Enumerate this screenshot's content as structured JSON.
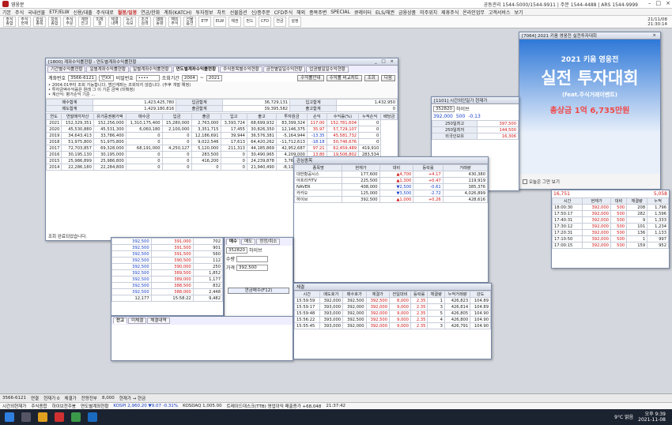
{
  "app": {
    "title": "영웅문",
    "status_bar": "공동관리 1544-5000/1544-9911 | 주문 1544-4488 | ARS 1544-9999"
  },
  "menu": [
    "기본",
    "주식",
    "국내선물",
    "ETF/ELW",
    "신용/대출",
    "주식대로",
    "월봉/일봉",
    "연금/한화",
    "계좌(KATCH)",
    "투자정보",
    "차트",
    "선물옵션",
    "신/종주문",
    "CFD주식",
    "해외",
    "종목주변",
    "SPECIAL",
    "큐레이터",
    "ELS/채권",
    "금융상품",
    "미주위치",
    "제휴주식",
    "온라인업무",
    "고객서비스",
    "보기"
  ],
  "toolbar": {
    "buttons": [
      "주식\n종합",
      "주식\n현재",
      "관심\n종목",
      "차트\n종합",
      "주식\n주문",
      "계좌\n잔고",
      "미체\n결",
      "체결\n내역",
      "뉴스\n속보",
      "조건\n검색",
      "매매\n동향",
      "해외\n주식",
      "선물\n옵션",
      "ETF",
      "ELW",
      "채권",
      "펀드",
      "CFD",
      "연금",
      "설정"
    ],
    "time": "21/11/08",
    "time2": "21:30:14"
  },
  "main_window": {
    "title": "[1800] 계좌수익률현황 - 연도별계좌수익률현황",
    "tabs": [
      "기간별수익률현황",
      "일별계좌수익률현황",
      "일별계좌수익률현황",
      "연도별계좌수익률현황",
      "주식종목별수익현황",
      "금전별일일수익현황",
      "업권별일일수익현황"
    ],
    "account_label": "계좌번호",
    "account": "3566-6121",
    "owner": "안XX",
    "pw_label": "비밀번호",
    "pw": "••••",
    "period_label": "조회기간",
    "year_from": "2004",
    "year_to": "2021",
    "btn_query": "조회",
    "btn_next": "다음",
    "btn_rate": "수익률안내",
    "btn_calc": "수익률 비교차트",
    "notes": [
      "• 2004.01부터 조회 가능합니다. 범인계좌는 조회되지 않습니다. (추후 개발 예정)",
      "• 투자금액수익률은 원래 그 이 기준 금액 (미확정)",
      "• 계산식: 평가손익 기준 ..."
    ],
    "sum_labels": [
      "매수합계",
      "매도합계",
      "입금합계",
      "출금합계",
      "입고합계",
      "출고합계"
    ],
    "sum_values": [
      "1,423,425,780",
      "1,429,180,816",
      "36,729,131",
      "39,395,582",
      "1,432,950",
      "0"
    ],
    "cols": [
      "연도",
      "연말매각자산",
      "유가증권평가액",
      "매수금",
      "입금",
      "출금",
      "입고",
      "출고",
      "투자원금",
      "손익",
      "수익률(%)",
      "누적손익",
      "배당금"
    ],
    "rows": [
      [
        "2021",
        "152,329,351",
        "152,256,000",
        "1,310,175,400",
        "15,280,000",
        "2,763,000",
        "3,393,724",
        "68,699,932",
        "83,399,324",
        "117.00",
        "152,781,604",
        "0"
      ],
      [
        "2020",
        "45,530,880",
        "45,531,300",
        "6,060,180",
        "2,100,000",
        "3,351,715",
        "17,455",
        "30,826,350",
        "12,146,375",
        "35.97",
        "57,729,107",
        "0"
      ],
      [
        "2019",
        "34,643,413",
        "33,786,400",
        "0",
        "0",
        "12,186,691",
        "39,944",
        "36,576,381",
        "-5,164,944",
        "-13.35",
        "45,581,732",
        "0"
      ],
      [
        "2018",
        "51,975,800",
        "51,975,800",
        "0",
        "0",
        "9,022,546",
        "17,613",
        "64,420,262",
        "-11,712,613",
        "-18.18",
        "50,746,676",
        "0"
      ],
      [
        "2017",
        "72,703,857",
        "69,328,000",
        "68,191,000",
        "4,250,127",
        "5,120,000",
        "211,313",
        "44,185,869",
        "42,952,687",
        "97.21",
        "62,459,489",
        "419,910"
      ],
      [
        "2016",
        "30,195,130",
        "30,195,000",
        "0",
        "0",
        "283,500",
        "0",
        "30,490,965",
        "4,209,000",
        "13.80",
        "19,506,802",
        "283,534"
      ],
      [
        "2015",
        "25,986,899",
        "25,986,800",
        "0",
        "0",
        "416,200",
        "0",
        "24,239,878",
        "3,762,000",
        "15.60",
        "15,297,802",
        "354,000"
      ],
      [
        "2014",
        "22,286,180",
        "22,284,800",
        "0",
        "0",
        "0",
        "0",
        "21,940,490",
        "-8,113,000",
        "-36.98",
        "11,535,802",
        "61,940"
      ]
    ],
    "footer": "조회 완료되었습니다."
  },
  "ad": {
    "title": "[7064] 2021 키움 영웅전 실전투자대회",
    "year_line": "2021 키움 영웅전",
    "headline": "실전 투자대회",
    "sub": "(feat.주식거래이벤트)",
    "prize": "총상금 1억 6,735만원",
    "check_label": "오늘은 그만 보기"
  },
  "quote_window": {
    "title": "[1101] 시간외단일가 현재가",
    "code": "352820",
    "name": "하이브",
    "price": "392,000",
    "change": "500",
    "rate": "-0.13",
    "labels": [
      "250일최고",
      "250일최저",
      "외국인보유"
    ],
    "values": [
      "397,500",
      "144,500",
      "16,306"
    ],
    "bars": [
      "80:30"
    ]
  },
  "order_window": {
    "title": "주식주문",
    "tabs": [
      "매수",
      "매도",
      "정정/취소"
    ],
    "code": "352820",
    "name": "하이브",
    "qty_label": "수량",
    "price_label": "가격",
    "btn_buy": "현금매수(F12)",
    "unit": "392,500"
  },
  "orderbook": {
    "prices": [
      "392,500",
      "392,500",
      "392,500",
      "392,500",
      "392,500",
      "392,500",
      "392,500",
      "392,500",
      "392,500"
    ],
    "asks": [
      "391,000",
      "391,500",
      "391,500",
      "390,500",
      "390,000",
      "389,500",
      "389,000",
      "388,500",
      "388,000"
    ],
    "qtys": [
      "702",
      "901",
      "560",
      "112",
      "250",
      "1,852",
      "1,177",
      "832",
      "2,448"
    ],
    "total": "12,177",
    "time": "15:58:22",
    "remain": "9,482"
  },
  "stock_list": {
    "cols": [
      "종목명",
      "현재가",
      "대비",
      "등락률",
      "거래량"
    ],
    "rows": [
      [
        "대한항공시스",
        "177,600",
        "▲4,700",
        "+4.17",
        "430,380"
      ],
      [
        "아프리카TV",
        "225,500",
        "▲1,300",
        "+0.47",
        "119,919"
      ],
      [
        "NAVER",
        "408,000",
        "▼2,500",
        "-0.61",
        "385,376"
      ],
      [
        "카카오",
        "125,000",
        "▼3,500",
        "-2.72",
        "4,026,899"
      ],
      [
        "하이브",
        "392,500",
        "▲1,000",
        "+0.26",
        "428,616"
      ]
    ]
  },
  "conclusion": {
    "title": "체결",
    "cols": [
      "시간",
      "매도호가",
      "매수호가",
      "체결가",
      "전일대비",
      "등락률",
      "체결량",
      "누적거래량",
      "강도"
    ],
    "rows": [
      [
        "15:59:59",
        "392,000",
        "392,500",
        "392,500",
        "8,000",
        "2.35",
        "1",
        "426,823",
        "104.89"
      ],
      [
        "15:59:17",
        "393,000",
        "392,000",
        "392,000",
        "9,000",
        "2.35",
        "3",
        "426,814",
        "104.89"
      ],
      [
        "15:59:48",
        "393,000",
        "392,000",
        "392,000",
        "9,000",
        "2.35",
        "5",
        "426,805",
        "104.90"
      ],
      [
        "15:56:22",
        "393,000",
        "392,500",
        "392,500",
        "9,000",
        "2.35",
        "4",
        "426,800",
        "104.90"
      ],
      [
        "15:55:45",
        "393,000",
        "392,000",
        "392,000",
        "9,000",
        "2.35",
        "3",
        "426,791",
        "104.90"
      ]
    ]
  },
  "right_panel": {
    "cols": [
      "시간",
      "현재가",
      "대비",
      "체결량",
      "누적"
    ],
    "rows": [
      [
        "18:00:30",
        "392,000",
        "500",
        "208",
        "1,796"
      ],
      [
        "17:50:17",
        "392,000",
        "500",
        "282",
        "1,596"
      ],
      [
        "17:40:31",
        "392,000",
        "500",
        "9",
        "1,333"
      ],
      [
        "17:30:12",
        "392,000",
        "500",
        "101",
        "1,234"
      ],
      [
        "17:20:31",
        "392,000",
        "500",
        "136",
        "1,133"
      ],
      [
        "17:10:50",
        "392,000",
        "500",
        "1",
        "997"
      ],
      [
        "17:00:15",
        "392,000",
        "500",
        "159",
        "952"
      ]
    ],
    "header_val": "16,751",
    "foreign": "5,058"
  },
  "taskbar1": [
    "3566-6121",
    "연결",
    "현재가 0",
    "체결가",
    "잔량전부",
    "8,000",
    "현재가 → 현금"
  ],
  "taskbar2": [
    "시간외현재가",
    "주식종합",
    "하이브전주봉",
    "연도별계좌현황"
  ],
  "ticker": {
    "kospi": "KOSPI 2,960.20 ▼9.07 -0.31%",
    "kosdaq": "KOSDAQ 1,005.00",
    "news": "트레이드대스크(TTB) 영업이익 매출증가 +68,048",
    "time": "21:37:42"
  },
  "win": {
    "time": "오후 9:39",
    "date": "2021-11-08",
    "weather": "9°C 맑음"
  }
}
